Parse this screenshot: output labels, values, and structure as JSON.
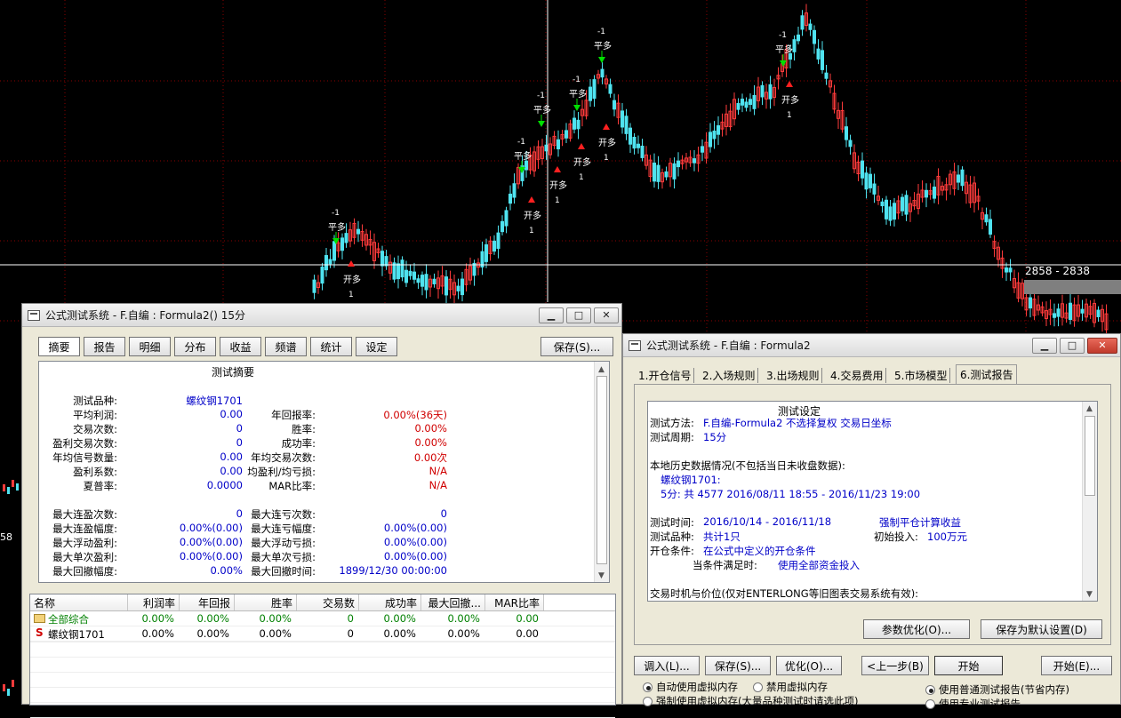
{
  "chart": {
    "price_range_label": "2858 - 2838",
    "left_edge_label": "58",
    "signals": [
      {
        "label_top": "-1",
        "label_action": "平多"
      },
      {
        "label_top": "-1",
        "label_action": "平多"
      },
      {
        "label_top": "-1",
        "label_action": "平多"
      },
      {
        "label_top": "-1",
        "label_action": "平多"
      },
      {
        "label_top": "-1",
        "label_action": "平多"
      },
      {
        "label_top": "-1",
        "label_action": "平多"
      }
    ],
    "entries": [
      {
        "label_action": "开多",
        "label_bottom": "1"
      },
      {
        "label_action": "开多",
        "label_bottom": "1"
      },
      {
        "label_action": "开多",
        "label_bottom": "1"
      },
      {
        "label_action": "开多",
        "label_bottom": "1"
      },
      {
        "label_action": "开多",
        "label_bottom": "1"
      },
      {
        "label_action": "开多",
        "label_bottom": "1"
      }
    ]
  },
  "left_window": {
    "title": "公式测试系统 - F.自编 : Formula2() 15分",
    "tabs": [
      "摘要",
      "报告",
      "明细",
      "分布",
      "收益",
      "频谱",
      "统计",
      "设定"
    ],
    "save_label": "保存(S)...",
    "summary_title": "测试摘要",
    "rows_left": [
      {
        "label": "测试品种:",
        "value": "螺纹钢1701"
      },
      {
        "label": "平均利润:",
        "value": "0.00"
      },
      {
        "label": "交易次数:",
        "value": "0"
      },
      {
        "label": "盈利交易次数:",
        "value": "0"
      },
      {
        "label": "年均信号数量:",
        "value": "0.00"
      },
      {
        "label": "盈利系数:",
        "value": "0.00"
      },
      {
        "label": "夏普率:",
        "value": "0.0000"
      }
    ],
    "rows_right": [
      {
        "label": "年回报率:",
        "value": "0.00%(36天)"
      },
      {
        "label": "胜率:",
        "value": "0.00%"
      },
      {
        "label": "成功率:",
        "value": "0.00%"
      },
      {
        "label": "年均交易次数:",
        "value": "0.00次"
      },
      {
        "label": "均盈利/均亏损:",
        "value": "N/A"
      },
      {
        "label": "MAR比率:",
        "value": "N/A"
      }
    ],
    "rows2_left": [
      {
        "label": "最大连盈次数:",
        "value": "0"
      },
      {
        "label": "最大连盈幅度:",
        "value": "0.00%(0.00)"
      },
      {
        "label": "最大浮动盈利:",
        "value": "0.00%(0.00)"
      },
      {
        "label": "最大单次盈利:",
        "value": "0.00%(0.00)"
      },
      {
        "label": "最大回撤幅度:",
        "value": "0.00%"
      }
    ],
    "rows2_right": [
      {
        "label": "最大连亏次数:",
        "value": "0"
      },
      {
        "label": "最大连亏幅度:",
        "value": "0.00%(0.00)"
      },
      {
        "label": "最大浮动亏损:",
        "value": "0.00%(0.00)"
      },
      {
        "label": "最大单次亏损:",
        "value": "0.00%(0.00)"
      },
      {
        "label": "最大回撤时间:",
        "value": "1899/12/30 00:00:00"
      }
    ],
    "table_headers": [
      "名称",
      "利润率",
      "年回报",
      "胜率",
      "交易数",
      "成功率",
      "最大回撤...",
      "MAR比率"
    ],
    "table_rows": [
      {
        "icon": "folder-icon",
        "cells": [
          "全部综合",
          "0.00%",
          "0.00%",
          "0.00%",
          "0",
          "0.00%",
          "0.00%",
          "0.00"
        ]
      },
      {
        "icon": "S",
        "cells": [
          "螺纹钢1701",
          "0.00%",
          "0.00%",
          "0.00%",
          "0",
          "0.00%",
          "0.00%",
          "0.00"
        ]
      }
    ]
  },
  "right_window": {
    "title": "公式测试系统 - F.自编 : Formula2",
    "tabs": [
      "1.开仓信号",
      "2.入场规则",
      "3.出场规则",
      "4.交易费用",
      "5.市场模型",
      "6.测试报告"
    ],
    "report_title": "测试设定",
    "lines": [
      {
        "a": "测试方法:",
        "b": "F.自编-Formula2    不选择复权    交易日坐标"
      },
      {
        "a": "测试周期:",
        "b": "15分"
      },
      {
        "a": "本地历史数据情况(不包括当日未收盘数据):",
        "b": ""
      },
      {
        "a": "",
        "b": "螺纹钢1701:"
      },
      {
        "a": "",
        "b": "5分: 共 4577 2016/08/11 18:55 - 2016/11/23 19:00"
      },
      {
        "a": "测试时间:",
        "b": "2016/10/14 - 2016/11/18",
        "c": "强制平仓计算收益"
      },
      {
        "a": "测试品种:",
        "b": "共计1只",
        "c_label": "初始投入:",
        "c": "100万元"
      },
      {
        "a": "开仓条件:",
        "b": "在公式中定义的开仓条件"
      },
      {
        "a": "当条件满足时:",
        "b": "使用全部资金投入"
      },
      {
        "a": "交易时机与价位(仅对ENTERLONG等旧图表交易系统有效):",
        "b": ""
      }
    ],
    "btn_param": "参数优化(O)...",
    "btn_save_default": "保存为默认设置(D)",
    "btn_load": "调入(L)...",
    "btn_save": "保存(S)...",
    "btn_optimize": "优化(O)...",
    "btn_prev": "<上一步(B)",
    "btn_start": "开始",
    "btn_start2": "开始(E)...",
    "radio_auto": "自动使用虚拟内存",
    "radio_disable": "禁用虚拟内存",
    "radio_force": "强制使用虚拟内存(大量品种测试时请选此项)",
    "radio_normal": "使用普通测试报告(节省内存)",
    "radio_pro": "使用专业测试报告"
  }
}
